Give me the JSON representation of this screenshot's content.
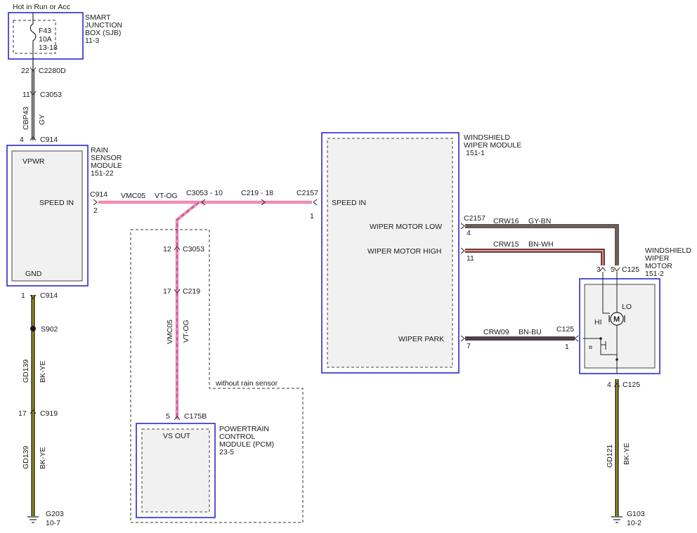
{
  "header": {
    "power_note": "Hot in Run or Acc"
  },
  "sjb": {
    "name_l1": "SMART",
    "name_l2": "JUNCTION",
    "name_l3": "BOX (SJB)",
    "ref": "11-3",
    "fuse": "F43",
    "amps": "10A",
    "fuse_ref": "13-18"
  },
  "connectors": {
    "c2280d_pin": "22",
    "c2280d": "C2280D",
    "c3053_top_pin": "11",
    "c3053_top": "C3053",
    "c914_top_pin": "4",
    "c914_top": "C914",
    "c914_speed": "C914",
    "c914_speed_pin": "2",
    "c914_gnd_pin": "1",
    "c914_gnd": "C914",
    "c919_pin": "17",
    "c919": "C919",
    "splice": "S902",
    "c3053_10": "C3053 - 10",
    "c219_18": "C219 - 18",
    "c2157_speed": "C2157",
    "c2157_speed_pin": "1",
    "c3053_mid_pin": "12",
    "c3053_mid": "C3053",
    "c219_pin": "17",
    "c219": "C219",
    "c175b_pin": "5",
    "c175b": "C175B",
    "c2157_low": "C2157",
    "c2157_low_pin": "4",
    "c2157_high_pin": "11",
    "c2157_park_pin": "7",
    "c125_motor": "C125",
    "c125_pin3": "3",
    "c125_pin5": "5",
    "c125_park": "C125",
    "c125_park_pin": "1",
    "c125_gnd_pin": "4",
    "c125_gnd": "C125"
  },
  "wires": {
    "cbp43": "CBP43",
    "gy": "GY",
    "vmc05": "VMC05",
    "vt_og": "VT-OG",
    "gd139": "GD139",
    "bk_ye": "BK-YE",
    "crw16": "CRW16",
    "gy_bn": "GY-BN",
    "crw15": "CRW15",
    "bn_wh": "BN-WH",
    "crw09": "CRW09",
    "bn_bu": "BN-BU",
    "gd121": "GD121"
  },
  "rain_sensor": {
    "name_l1": "RAIN",
    "name_l2": "SENSOR",
    "name_l3": "MODULE",
    "ref": "151-22",
    "vpwr": "VPWR",
    "speed_in": "SPEED IN",
    "gnd": "GND"
  },
  "pcm": {
    "name_l1": "POWERTRAIN",
    "name_l2": "CONTROL",
    "name_l3": "MODULE (PCM)",
    "ref": "23-5",
    "vs_out": "VS OUT",
    "note": "without rain sensor"
  },
  "wiper_module": {
    "name_l1": "WINDSHIELD",
    "name_l2": "WIPER MODULE",
    "ref": "151-1",
    "speed_in": "SPEED IN",
    "motor_low": "WIPER MOTOR LOW",
    "motor_high": "WIPER MOTOR HIGH",
    "park": "WIPER PARK"
  },
  "wiper_motor": {
    "name_l1": "WINDSHIELD",
    "name_l2": "WIPER",
    "name_l3": "MOTOR",
    "ref": "151-2",
    "hi": "HI",
    "lo": "LO",
    "symbol": "M"
  },
  "grounds": {
    "g203": "G203",
    "g203_ref": "10-7",
    "g103": "G103",
    "g103_ref": "10-2"
  },
  "colors": {
    "module_border": "#2a2ad0",
    "wire_pink": "#f08cb4",
    "wire_violet": "#7b3fa0",
    "wire_gray": "#7a7a7a",
    "wire_black": "#1a1a1a",
    "wire_yellow": "#d4d400",
    "wire_brown": "#7a3a1a",
    "wire_white": "#ffffff",
    "wire_blue": "#2a4ab8"
  }
}
